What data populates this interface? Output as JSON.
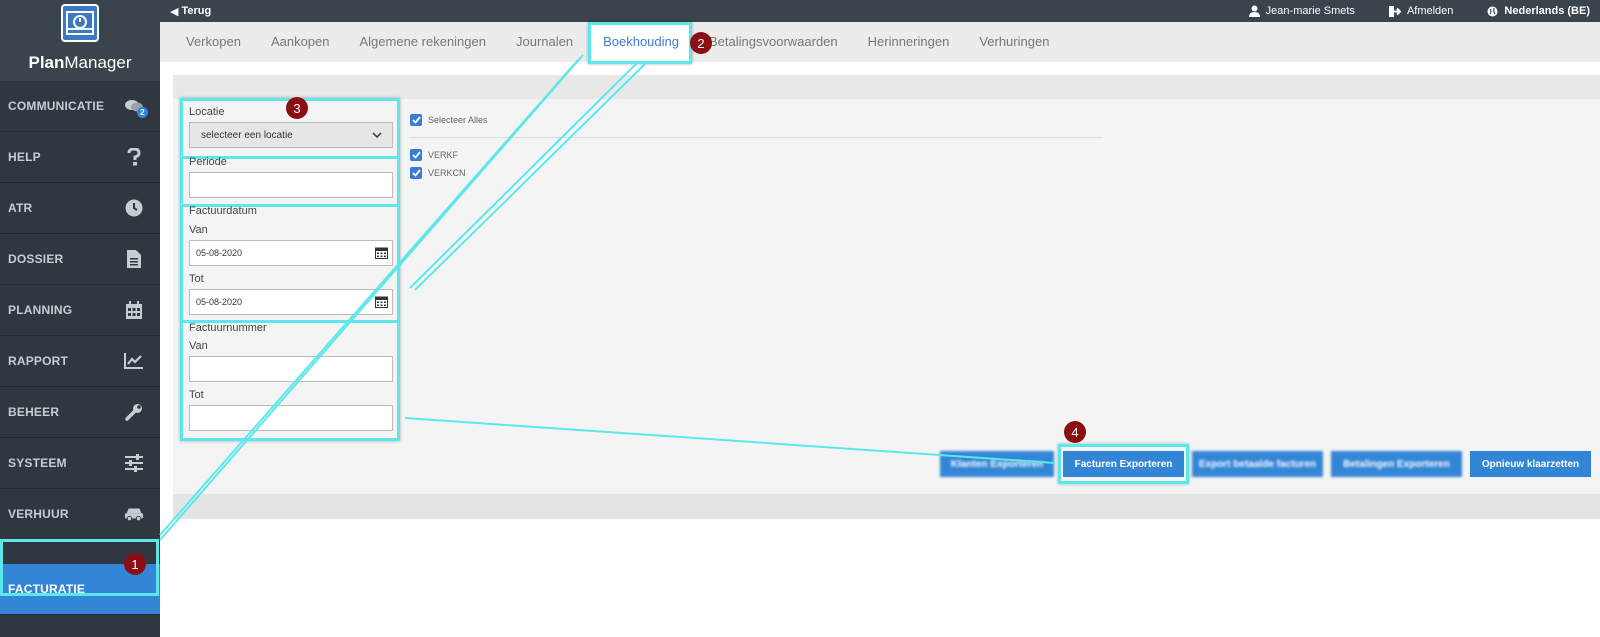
{
  "app": {
    "name_bold": "Plan",
    "name_rest": "Manager"
  },
  "topbar": {
    "back_label": "Terug",
    "user_label": "Jean-marie Smets",
    "logout_label": "Afmelden",
    "language_label": "Nederlands (BE)"
  },
  "sidebar": {
    "items": [
      {
        "label": "COMMUNICATIE",
        "icon": "chat-icon",
        "badge": "2"
      },
      {
        "label": "HELP",
        "icon": "question-icon"
      },
      {
        "label": "ATR",
        "icon": "clock-icon"
      },
      {
        "label": "DOSSIER",
        "icon": "document-icon"
      },
      {
        "label": "PLANNING",
        "icon": "calendar-icon"
      },
      {
        "label": "RAPPORT",
        "icon": "chart-icon"
      },
      {
        "label": "BEHEER",
        "icon": "wrench-icon"
      },
      {
        "label": "SYSTEEM",
        "icon": "sliders-icon"
      },
      {
        "label": "VERHUUR",
        "icon": "car-icon"
      },
      {
        "label": "FACTURATIE",
        "icon": "invoice-icon",
        "active": true
      }
    ]
  },
  "tabs": [
    "Verkopen",
    "Aankopen",
    "Algemene rekeningen",
    "Journalen",
    "Boekhouding",
    "Betalingsvoorwaarden",
    "Herinneringen",
    "Verhuringen"
  ],
  "filters": {
    "locatie_label": "Locatie",
    "locatie_value": "selecteer een locatie",
    "periode_label": "Periode",
    "periode_value": "",
    "factuurdatum_label": "Factuurdatum",
    "van_label": "Van",
    "tot_label": "Tot",
    "date_from": "05-08-2020",
    "date_to": "05-08-2020",
    "factuurnummer_label": "Factuurnummer",
    "number_from": "",
    "number_to": ""
  },
  "journals": {
    "select_all_label": "Selecteer Alles",
    "items": [
      "VERKF",
      "VERKCN"
    ]
  },
  "buttons": {
    "blur1": "Klanten Exporteren",
    "export": "Facturen Exporteren",
    "blur2": "Export betaalde facturen",
    "blur3": "Betalingen Exporteren",
    "reset": "Opnieuw klaarzetten"
  },
  "steps": [
    "1",
    "2",
    "3",
    "4"
  ],
  "colors": {
    "accent": "#3385d6",
    "highlight": "#5ce8ea",
    "step": "#8b0f12"
  }
}
